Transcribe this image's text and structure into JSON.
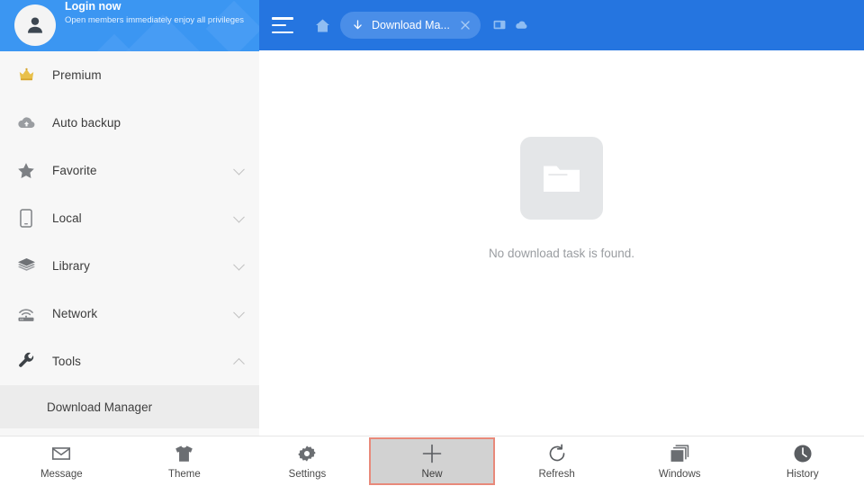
{
  "colors": {
    "toolbar_blue": "#2575e0",
    "banner_blue": "#3b96f2",
    "tab_pill_blue": "#4a8ee8",
    "sidebar_bg": "#f7f7f7",
    "sub_item_selected_bg": "#ececec",
    "highlight_border": "#e8897a",
    "pressed_fill": "#d2d2d2",
    "crown_gold": "#e8b93c",
    "empty_box": "#e4e6e8",
    "muted_text": "#9a9da1"
  },
  "sidebar": {
    "login": {
      "avatar_icon": "user-avatar-icon",
      "title": "Login now",
      "subtitle": "Open members immediately enjoy all privileges"
    },
    "items": [
      {
        "label": "Premium",
        "icon": "crown-icon",
        "expandable": false,
        "expanded": false
      },
      {
        "label": "Auto backup",
        "icon": "cloud-upload-icon",
        "expandable": false,
        "expanded": false
      },
      {
        "label": "Favorite",
        "icon": "star-icon",
        "expandable": true,
        "expanded": false
      },
      {
        "label": "Local",
        "icon": "phone-icon",
        "expandable": true,
        "expanded": false
      },
      {
        "label": "Library",
        "icon": "layers-icon",
        "expandable": true,
        "expanded": false
      },
      {
        "label": "Network",
        "icon": "router-wifi-icon",
        "expandable": true,
        "expanded": false
      },
      {
        "label": "Tools",
        "icon": "wrench-icon",
        "expandable": true,
        "expanded": true
      }
    ],
    "sub_items": [
      {
        "label": "Download Manager",
        "parent": "Tools",
        "selected": true
      }
    ]
  },
  "toolbar": {
    "menu_icon": "hamburger-menu-icon",
    "home_icon": "home-icon",
    "tab": {
      "icon": "download-arrow-icon",
      "title": "Download Ma...",
      "close_icon": "close-icon"
    },
    "window_icon": "window-icon",
    "cloud_icon": "cloud-icon"
  },
  "content": {
    "empty_state": {
      "icon": "empty-folder-icon",
      "message": "No download task is found."
    }
  },
  "bottom_bar": {
    "items": [
      {
        "label": "Message",
        "icon": "envelope-icon",
        "active": false
      },
      {
        "label": "Theme",
        "icon": "tshirt-icon",
        "active": false
      },
      {
        "label": "Settings",
        "icon": "gear-icon",
        "active": false
      },
      {
        "label": "New",
        "icon": "plus-icon",
        "active": true
      },
      {
        "label": "Refresh",
        "icon": "refresh-icon",
        "active": false
      },
      {
        "label": "Windows",
        "icon": "windows-stack-icon",
        "active": false
      },
      {
        "label": "History",
        "icon": "clock-icon",
        "active": false
      }
    ]
  }
}
